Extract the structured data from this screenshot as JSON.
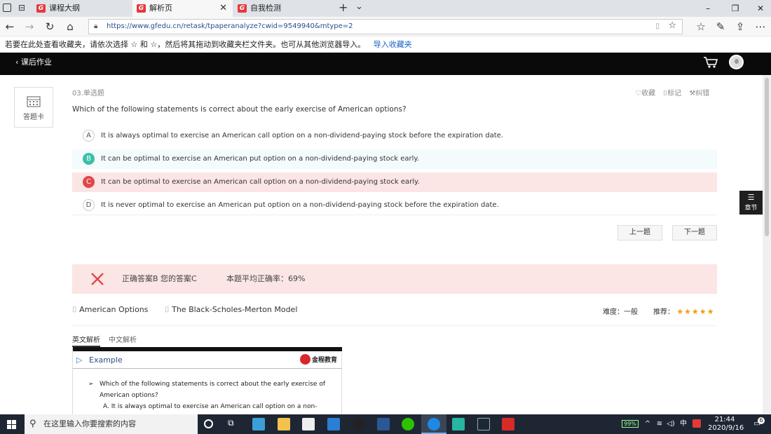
{
  "tabs": [
    {
      "label": "课程大纲"
    },
    {
      "label": "解析页"
    },
    {
      "label": "自我检测"
    }
  ],
  "tabs_extra": {
    "new_tab": "+",
    "tab_menu": "⌄"
  },
  "window": {
    "minimize": "–",
    "maximize": "❐",
    "close": "✕"
  },
  "address": {
    "url": "https://www.gfedu.cn/retask/tpaperanalyze?cwid=9549940&mtype=2"
  },
  "favbar": {
    "text": "若要在此处查看收藏夹，请依次选择 ☆ 和 ☆，然后将其拖动到收藏夹栏文件夹。也可从其他浏览器导入。",
    "link": "导入收藏夹"
  },
  "site": {
    "back_label": "课后作业"
  },
  "sidebar": {
    "card_label": "答题卡"
  },
  "question": {
    "number": "03.单选题",
    "text": "Which of the following statements is correct about the early exercise of American options?",
    "actions": {
      "favorite": "收藏",
      "mark": "标记",
      "report": "纠错"
    },
    "options": [
      {
        "letter": "A",
        "text": "It is always optimal to exercise an American call option on a non-dividend-paying stock before the expiration date.",
        "state": "normal"
      },
      {
        "letter": "B",
        "text": "It can be optimal to exercise an American put option on a non-dividend-paying stock early.",
        "state": "correct"
      },
      {
        "letter": "C",
        "text": "It can be optimal to exercise an American call option on a non-dividend-paying stock early.",
        "state": "wrong"
      },
      {
        "letter": "D",
        "text": "It is never optimal to exercise an American put option on a non-dividend-paying stock before the expiration date.",
        "state": "normal"
      }
    ],
    "prev": "上一题",
    "next": "下一题"
  },
  "result": {
    "answer_text": "正确答案B 您的答案C",
    "avg_text": "本题平均正确率：69%"
  },
  "tags": {
    "tag1": "American Options",
    "tag2": "The Black-Scholes-Merton Model",
    "difficulty": "难度：一般",
    "recommend_label": "推荐：",
    "stars": 5
  },
  "analysis_tabs": [
    {
      "label": "英文解析"
    },
    {
      "label": "中文解析"
    }
  ],
  "slide": {
    "title": "Example",
    "brand": "金程教育",
    "q_line1": "Which of the following statements is correct about the early exercise of",
    "q_line2": "American options?",
    "a_line": "A.  It is always optimal to exercise an American call option on a non-"
  },
  "chapter_tab": {
    "label": "章节"
  },
  "taskbar": {
    "search_placeholder": "在这里输入你要搜索的内容",
    "battery": "99%",
    "ime": "中",
    "time": "21:44",
    "date": "2020/9/16",
    "notif_count": "6"
  },
  "colors": {
    "correct": "#3cbfa8",
    "wrong": "#e04848",
    "correct_bg": "#f3fbfd",
    "wrong_bg": "#fbe5e5",
    "star": "#f39c12",
    "link": "#1a63c6"
  }
}
